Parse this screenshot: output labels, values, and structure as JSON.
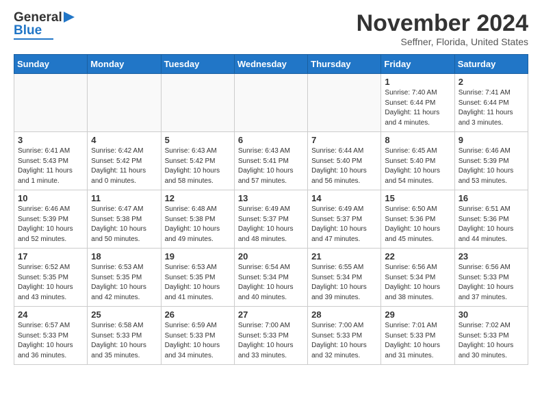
{
  "header": {
    "logo_general": "General",
    "logo_blue": "Blue",
    "month_title": "November 2024",
    "location": "Seffner, Florida, United States"
  },
  "weekdays": [
    "Sunday",
    "Monday",
    "Tuesday",
    "Wednesday",
    "Thursday",
    "Friday",
    "Saturday"
  ],
  "weeks": [
    [
      {
        "day": "",
        "info": ""
      },
      {
        "day": "",
        "info": ""
      },
      {
        "day": "",
        "info": ""
      },
      {
        "day": "",
        "info": ""
      },
      {
        "day": "",
        "info": ""
      },
      {
        "day": "1",
        "info": "Sunrise: 7:40 AM\nSunset: 6:44 PM\nDaylight: 11 hours\nand 4 minutes."
      },
      {
        "day": "2",
        "info": "Sunrise: 7:41 AM\nSunset: 6:44 PM\nDaylight: 11 hours\nand 3 minutes."
      }
    ],
    [
      {
        "day": "3",
        "info": "Sunrise: 6:41 AM\nSunset: 5:43 PM\nDaylight: 11 hours\nand 1 minute."
      },
      {
        "day": "4",
        "info": "Sunrise: 6:42 AM\nSunset: 5:42 PM\nDaylight: 11 hours\nand 0 minutes."
      },
      {
        "day": "5",
        "info": "Sunrise: 6:43 AM\nSunset: 5:42 PM\nDaylight: 10 hours\nand 58 minutes."
      },
      {
        "day": "6",
        "info": "Sunrise: 6:43 AM\nSunset: 5:41 PM\nDaylight: 10 hours\nand 57 minutes."
      },
      {
        "day": "7",
        "info": "Sunrise: 6:44 AM\nSunset: 5:40 PM\nDaylight: 10 hours\nand 56 minutes."
      },
      {
        "day": "8",
        "info": "Sunrise: 6:45 AM\nSunset: 5:40 PM\nDaylight: 10 hours\nand 54 minutes."
      },
      {
        "day": "9",
        "info": "Sunrise: 6:46 AM\nSunset: 5:39 PM\nDaylight: 10 hours\nand 53 minutes."
      }
    ],
    [
      {
        "day": "10",
        "info": "Sunrise: 6:46 AM\nSunset: 5:39 PM\nDaylight: 10 hours\nand 52 minutes."
      },
      {
        "day": "11",
        "info": "Sunrise: 6:47 AM\nSunset: 5:38 PM\nDaylight: 10 hours\nand 50 minutes."
      },
      {
        "day": "12",
        "info": "Sunrise: 6:48 AM\nSunset: 5:38 PM\nDaylight: 10 hours\nand 49 minutes."
      },
      {
        "day": "13",
        "info": "Sunrise: 6:49 AM\nSunset: 5:37 PM\nDaylight: 10 hours\nand 48 minutes."
      },
      {
        "day": "14",
        "info": "Sunrise: 6:49 AM\nSunset: 5:37 PM\nDaylight: 10 hours\nand 47 minutes."
      },
      {
        "day": "15",
        "info": "Sunrise: 6:50 AM\nSunset: 5:36 PM\nDaylight: 10 hours\nand 45 minutes."
      },
      {
        "day": "16",
        "info": "Sunrise: 6:51 AM\nSunset: 5:36 PM\nDaylight: 10 hours\nand 44 minutes."
      }
    ],
    [
      {
        "day": "17",
        "info": "Sunrise: 6:52 AM\nSunset: 5:35 PM\nDaylight: 10 hours\nand 43 minutes."
      },
      {
        "day": "18",
        "info": "Sunrise: 6:53 AM\nSunset: 5:35 PM\nDaylight: 10 hours\nand 42 minutes."
      },
      {
        "day": "19",
        "info": "Sunrise: 6:53 AM\nSunset: 5:35 PM\nDaylight: 10 hours\nand 41 minutes."
      },
      {
        "day": "20",
        "info": "Sunrise: 6:54 AM\nSunset: 5:34 PM\nDaylight: 10 hours\nand 40 minutes."
      },
      {
        "day": "21",
        "info": "Sunrise: 6:55 AM\nSunset: 5:34 PM\nDaylight: 10 hours\nand 39 minutes."
      },
      {
        "day": "22",
        "info": "Sunrise: 6:56 AM\nSunset: 5:34 PM\nDaylight: 10 hours\nand 38 minutes."
      },
      {
        "day": "23",
        "info": "Sunrise: 6:56 AM\nSunset: 5:33 PM\nDaylight: 10 hours\nand 37 minutes."
      }
    ],
    [
      {
        "day": "24",
        "info": "Sunrise: 6:57 AM\nSunset: 5:33 PM\nDaylight: 10 hours\nand 36 minutes."
      },
      {
        "day": "25",
        "info": "Sunrise: 6:58 AM\nSunset: 5:33 PM\nDaylight: 10 hours\nand 35 minutes."
      },
      {
        "day": "26",
        "info": "Sunrise: 6:59 AM\nSunset: 5:33 PM\nDaylight: 10 hours\nand 34 minutes."
      },
      {
        "day": "27",
        "info": "Sunrise: 7:00 AM\nSunset: 5:33 PM\nDaylight: 10 hours\nand 33 minutes."
      },
      {
        "day": "28",
        "info": "Sunrise: 7:00 AM\nSunset: 5:33 PM\nDaylight: 10 hours\nand 32 minutes."
      },
      {
        "day": "29",
        "info": "Sunrise: 7:01 AM\nSunset: 5:33 PM\nDaylight: 10 hours\nand 31 minutes."
      },
      {
        "day": "30",
        "info": "Sunrise: 7:02 AM\nSunset: 5:33 PM\nDaylight: 10 hours\nand 30 minutes."
      }
    ]
  ]
}
